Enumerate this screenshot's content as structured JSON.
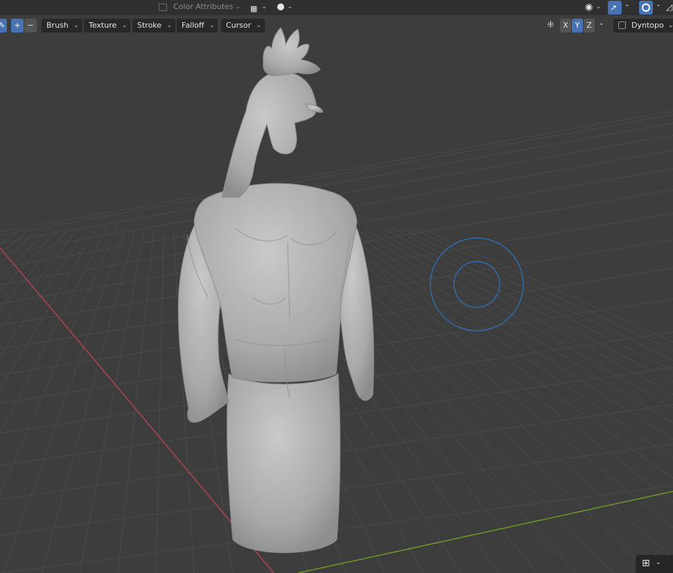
{
  "header": {
    "color_mode": "Color Attributes"
  },
  "toolbar": {
    "add": "+",
    "subtract": "−",
    "menus": [
      "Brush",
      "Texture",
      "Stroke",
      "Falloff",
      "Cursor"
    ],
    "axes": [
      "X",
      "Y",
      "Z"
    ],
    "dyntopo": "Dyntopo"
  },
  "colors": {
    "viewport_bg": "#3d3d3d",
    "header_bg": "#303030",
    "accent_blue": "#4772b3",
    "x_axis": "#b04550",
    "y_axis": "#6f9a2b",
    "brush_circle": "#2f6fb0",
    "mesh": "#b4b4b4"
  },
  "icons": {
    "sculpt_brush": "pen-icon",
    "view_overlays": "eye-icon",
    "gizmo": "gizmo-icon",
    "overlays": "overlays-icon",
    "symmetry": "mesh-symmetry-icon",
    "shading_mode": "shading-icon",
    "navigation": "grid-icon"
  }
}
